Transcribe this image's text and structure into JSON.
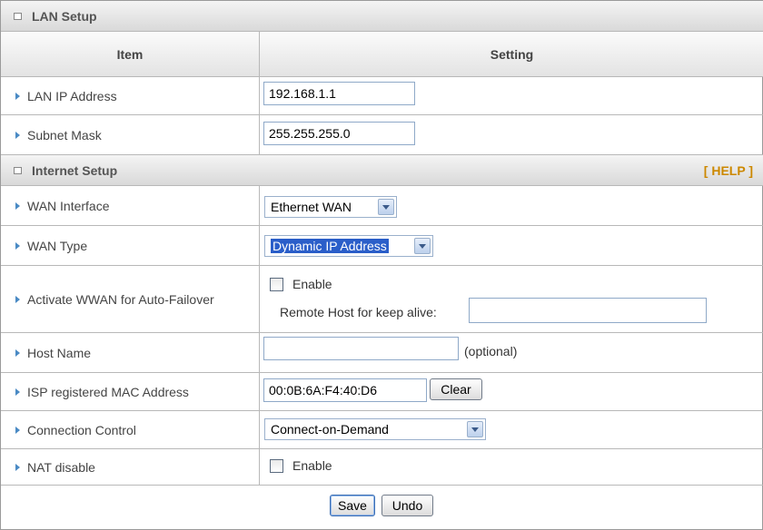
{
  "lan_setup": {
    "title": "LAN Setup",
    "col_item": "Item",
    "col_setting": "Setting",
    "ip_label": "LAN IP Address",
    "ip_value": "192.168.1.1",
    "mask_label": "Subnet Mask",
    "mask_value": "255.255.255.0"
  },
  "internet_setup": {
    "title": "Internet Setup",
    "help_link": "[ HELP ]",
    "wan_interface_label": "WAN Interface",
    "wan_interface_value": "Ethernet WAN",
    "wan_type_label": "WAN Type",
    "wan_type_value": "Dynamic IP Address",
    "wwan_label": "Activate WWAN for Auto-Failover",
    "wwan_enable_label": "Enable",
    "wwan_enabled": false,
    "remote_host_label": "Remote Host for keep alive:",
    "remote_host_value": "",
    "host_name_label": "Host Name",
    "host_name_value": "",
    "host_name_hint": "(optional)",
    "mac_label": "ISP registered MAC Address",
    "mac_value": "00:0B:6A:F4:40:D6",
    "clear_button": "Clear",
    "conn_control_label": "Connection Control",
    "conn_control_value": "Connect-on-Demand",
    "nat_label": "NAT disable",
    "nat_enable_label": "Enable",
    "nat_enabled": false
  },
  "footer": {
    "save_button": "Save",
    "undo_button": "Undo"
  },
  "colors": {
    "section_bg": "#dcdcdc",
    "help_color": "#cc8800",
    "arrow_color": "#4a8ac4",
    "selection_color": "#2a5ec9"
  }
}
